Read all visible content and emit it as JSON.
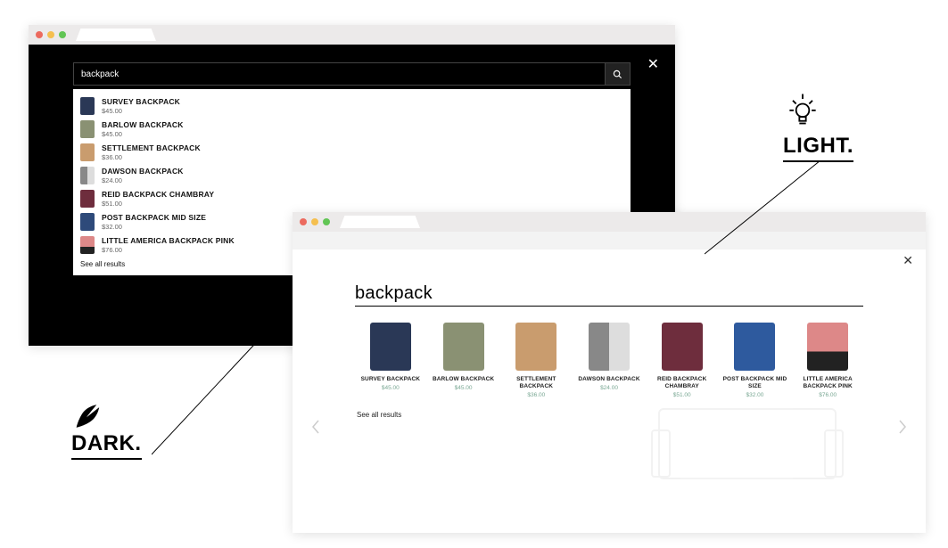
{
  "labels": {
    "dark": "DARK.",
    "light": "LIGHT."
  },
  "dark": {
    "search_value": "backpack",
    "see_all": "See all results",
    "results": [
      {
        "name": "SURVEY BACKPACK",
        "price": "$45.00",
        "swatch": "bp-navy"
      },
      {
        "name": "BARLOW BACKPACK",
        "price": "$45.00",
        "swatch": "bp-olive"
      },
      {
        "name": "SETTLEMENT BACKPACK",
        "price": "$36.00",
        "swatch": "bp-tan"
      },
      {
        "name": "DAWSON BACKPACK",
        "price": "$24.00",
        "swatch": "bp-grey"
      },
      {
        "name": "REID BACKPACK CHAMBRAY",
        "price": "$51.00",
        "swatch": "bp-maroon"
      },
      {
        "name": "POST BACKPACK MID SIZE",
        "price": "$32.00",
        "swatch": "bp-navy2"
      },
      {
        "name": "LITTLE AMERICA BACKPACK PINK",
        "price": "$76.00",
        "swatch": "bp-pink"
      }
    ]
  },
  "light": {
    "search_value": "backpack",
    "see_all": "See all results",
    "results": [
      {
        "name": "SURVEY BACKPACK",
        "price": "$45.00",
        "swatch": "bp-navy"
      },
      {
        "name": "BARLOW BACKPACK",
        "price": "$45.00",
        "swatch": "bp-olive"
      },
      {
        "name": "SETTLEMENT BACKPACK",
        "price": "$36.00",
        "swatch": "bp-tan"
      },
      {
        "name": "DAWSON BACKPACK",
        "price": "$24.00",
        "swatch": "bp-grey"
      },
      {
        "name": "REID BACKPACK CHAMBRAY",
        "price": "$51.00",
        "swatch": "bp-maroon"
      },
      {
        "name": "POST BACKPACK MID SIZE",
        "price": "$32.00",
        "swatch": "bp-blue"
      },
      {
        "name": "LITTLE AMERICA BACKPACK PINK",
        "price": "$76.00",
        "swatch": "bp-pink"
      }
    ]
  }
}
